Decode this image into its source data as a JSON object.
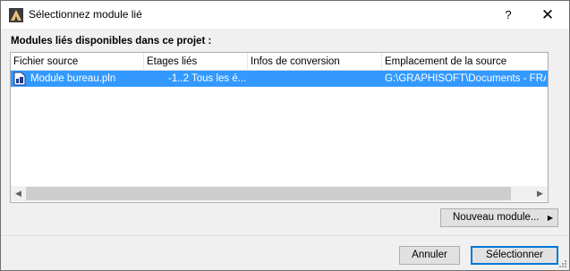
{
  "window": {
    "title": "Sélectionnez module lié",
    "help_label": "?",
    "close_label": "✕"
  },
  "section_label": "Modules liés disponibles dans ce projet :",
  "table": {
    "columns": [
      "Fichier source",
      "Etages liés",
      "Infos de conversion",
      "Emplacement de la source"
    ],
    "rows": [
      {
        "icon": "module-file-icon",
        "file": "Module bureau.pln",
        "stories": "-1..2 Tous les é...",
        "conversion": "",
        "location": "G:\\GRAPHISOFT\\Documents - FRA"
      }
    ],
    "selected_row": 0
  },
  "scrollbar": {
    "left_arrow": "◀",
    "right_arrow": "▶"
  },
  "buttons": {
    "new_module": "Nouveau module...",
    "new_module_arrow": "▶",
    "cancel": "Annuler",
    "select": "Sélectionner"
  },
  "colors": {
    "selection": "#3399ff",
    "default_button_border": "#0078d7",
    "dialog_bg": "#f0f0f0"
  }
}
